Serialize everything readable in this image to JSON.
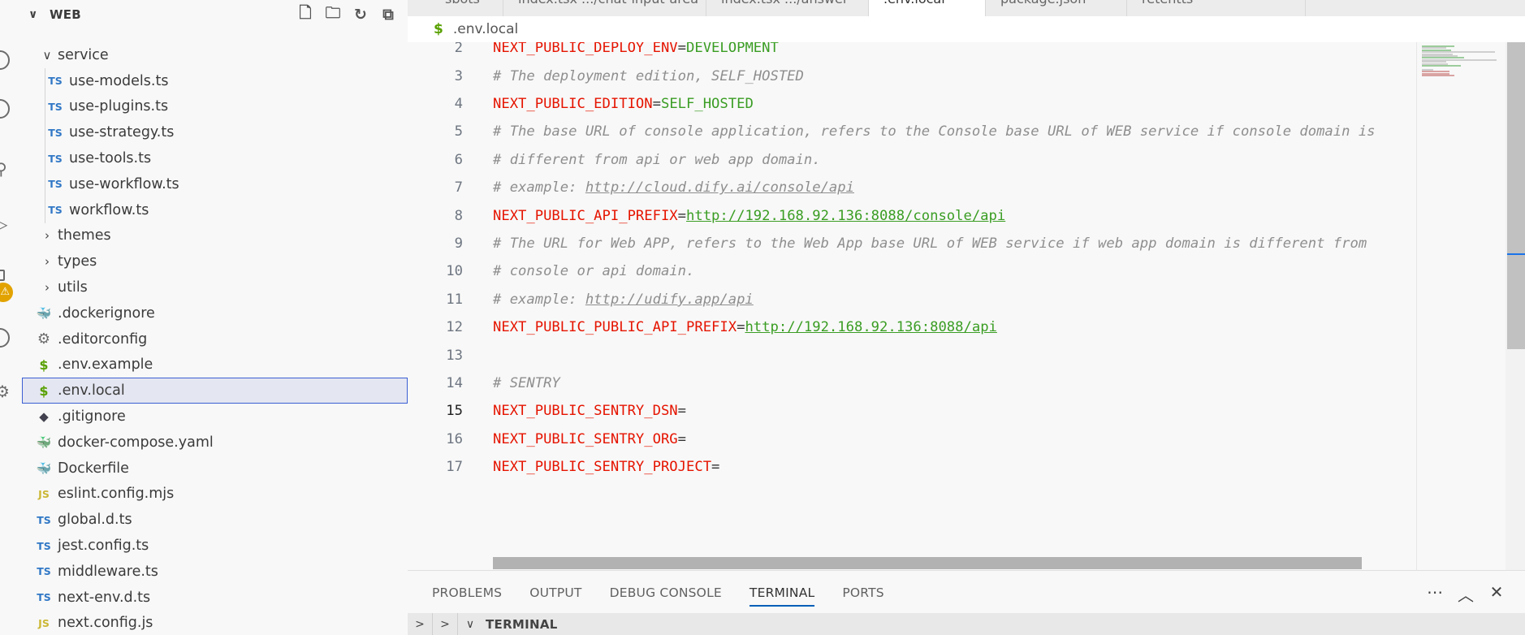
{
  "explorer": {
    "title": "WEB",
    "items": [
      {
        "label": "service",
        "type": "folder-open"
      },
      {
        "label": "use-models.ts",
        "type": "ts"
      },
      {
        "label": "use-plugins.ts",
        "type": "ts"
      },
      {
        "label": "use-strategy.ts",
        "type": "ts"
      },
      {
        "label": "use-tools.ts",
        "type": "ts"
      },
      {
        "label": "use-workflow.ts",
        "type": "ts"
      },
      {
        "label": "workflow.ts",
        "type": "ts"
      },
      {
        "label": "themes",
        "type": "folder-closed"
      },
      {
        "label": "types",
        "type": "folder-closed"
      },
      {
        "label": "utils",
        "type": "folder-closed"
      },
      {
        "label": ".dockerignore",
        "type": "docker"
      },
      {
        "label": ".editorconfig",
        "type": "gear"
      },
      {
        "label": ".env.example",
        "type": "env"
      },
      {
        "label": ".env.local",
        "type": "env"
      },
      {
        "label": ".gitignore",
        "type": "git"
      },
      {
        "label": "docker-compose.yaml",
        "type": "compose"
      },
      {
        "label": "Dockerfile",
        "type": "docker"
      },
      {
        "label": "eslint.config.mjs",
        "type": "js"
      },
      {
        "label": "global.d.ts",
        "type": "ts"
      },
      {
        "label": "jest.config.ts",
        "type": "ts"
      },
      {
        "label": "middleware.ts",
        "type": "ts"
      },
      {
        "label": "next-env.d.ts",
        "type": "ts"
      },
      {
        "label": "next.config.js",
        "type": "js"
      }
    ],
    "icon_badges": {
      "ts": "TS",
      "js": "JS",
      "env": "$"
    }
  },
  "tabs": [
    {
      "label": "sbots"
    },
    {
      "label": "index.tsx .../chat-input-area"
    },
    {
      "label": "index.tsx .../answer"
    },
    {
      "label": ".env.local"
    },
    {
      "label": "package.json"
    },
    {
      "label": "retentts"
    }
  ],
  "breadcrumb": {
    "file": ".env.local",
    "icon": "$"
  },
  "editor": {
    "lines": [
      {
        "n": "2",
        "key": "NEXT_PUBLIC_DEPLOY_ENV",
        "eq": "=",
        "val": "DEVELOPMENT"
      },
      {
        "n": "3",
        "comment": "# The deployment edition, SELF_HOSTED"
      },
      {
        "n": "4",
        "key": "NEXT_PUBLIC_EDITION",
        "eq": "=",
        "val": "SELF_HOSTED"
      },
      {
        "n": "5",
        "comment": "# The base URL of console application, refers to the Console base URL of WEB service if console domain is"
      },
      {
        "n": "6",
        "comment": "# different from api or web app domain."
      },
      {
        "n": "7",
        "comment": "# example: ",
        "url": "http://cloud.dify.ai/console/api"
      },
      {
        "n": "8",
        "key": "NEXT_PUBLIC_API_PREFIX",
        "eq": "=",
        "valurl": "http://192.168.92.136:8088/console/api"
      },
      {
        "n": "9",
        "comment": "# The URL for Web APP, refers to the Web App base URL of WEB service if web app domain is different from"
      },
      {
        "n": "10",
        "comment": "# console or api domain."
      },
      {
        "n": "11",
        "comment": "# example: ",
        "url": "http://udify.app/api"
      },
      {
        "n": "12",
        "key": "NEXT_PUBLIC_PUBLIC_API_PREFIX",
        "eq": "=",
        "valurl": "http://192.168.92.136:8088/api"
      },
      {
        "n": "13"
      },
      {
        "n": "14",
        "comment": "# SENTRY"
      },
      {
        "n": "15",
        "key": "NEXT_PUBLIC_SENTRY_DSN",
        "eq": "=",
        "current": true
      },
      {
        "n": "16",
        "key": "NEXT_PUBLIC_SENTRY_ORG",
        "eq": "="
      },
      {
        "n": "17",
        "key": "NEXT_PUBLIC_SENTRY_PROJECT",
        "eq": "="
      }
    ]
  },
  "panel": {
    "tabs": [
      {
        "label": "PROBLEMS"
      },
      {
        "label": "OUTPUT"
      },
      {
        "label": "DEBUG CONSOLE"
      },
      {
        "label": "TERMINAL",
        "active": true
      },
      {
        "label": "PORTS"
      }
    ],
    "section_label": "TERMINAL"
  },
  "colors": {
    "key": "#e51400",
    "value": "#3a9d23",
    "comment": "#8e8e8e",
    "accent": "#005fb8",
    "selection_border": "#3b5fd4"
  }
}
